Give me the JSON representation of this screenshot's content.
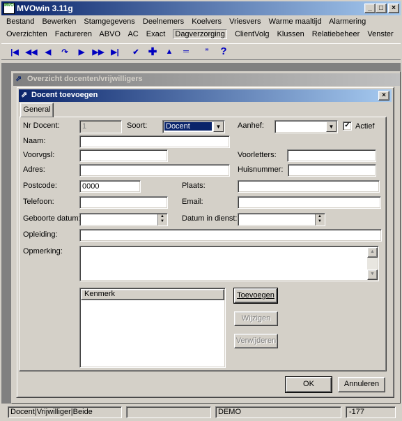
{
  "app": {
    "title": "MVOwin 3.11g",
    "logo_text": "MVO"
  },
  "menu_row1": [
    "Bestand",
    "Bewerken",
    "Stamgegevens",
    "Deelnemers",
    "Koelvers",
    "Vriesvers",
    "Warme maaltijd",
    "Alarmering"
  ],
  "menu_row2": [
    "Overzichten",
    "Factureren",
    "ABVO",
    "AC",
    "Exact",
    "Dagverzorging",
    "ClientVolg",
    "Klussen",
    "Relatiebeheer",
    "Venster"
  ],
  "toolbar_icons": [
    "first-record-icon",
    "rewind-icon",
    "previous-icon",
    "jump-icon",
    "next-icon",
    "fast-forward-icon",
    "last-record-icon",
    "confirm-icon",
    "add-icon",
    "edit-icon",
    "cancel-icon",
    "quote-icon",
    "help-icon"
  ],
  "child_window": {
    "title": "Overzicht docenten/vrijwilligers"
  },
  "dialog": {
    "title": "Docent toevoegen",
    "tab": "General",
    "labels": {
      "nr": "Nr Docent:",
      "soort": "Soort:",
      "aanhef": "Aanhef:",
      "actief": "Actief",
      "naam": "Naam:",
      "voorvgsl": "Voorvgsl:",
      "voorletters": "Voorletters:",
      "adres": "Adres:",
      "huisnummer": "Huisnummer:",
      "postcode": "Postcode:",
      "plaats": "Plaats:",
      "telefoon": "Telefoon:",
      "email": "Email:",
      "geboorte": "Geboorte datum:",
      "dienst": "Datum in dienst:",
      "opleiding": "Opleiding:",
      "opmerking": "Opmerking:"
    },
    "values": {
      "nr": "1",
      "soort": "Docent",
      "aanhef": "",
      "postcode": "0000",
      "actief": true
    },
    "kenmerk_header": "Kenmerk",
    "buttons": {
      "toevoegen": "Toevoegen",
      "wijzigen": "Wijzigen",
      "verwijderen": "Verwijderen",
      "ok": "OK",
      "annuleren": "Annuleren"
    }
  },
  "statusbar": {
    "mode": "Docent|Vrijwilliger|Beide",
    "db": "DEMO",
    "count": "-177"
  }
}
